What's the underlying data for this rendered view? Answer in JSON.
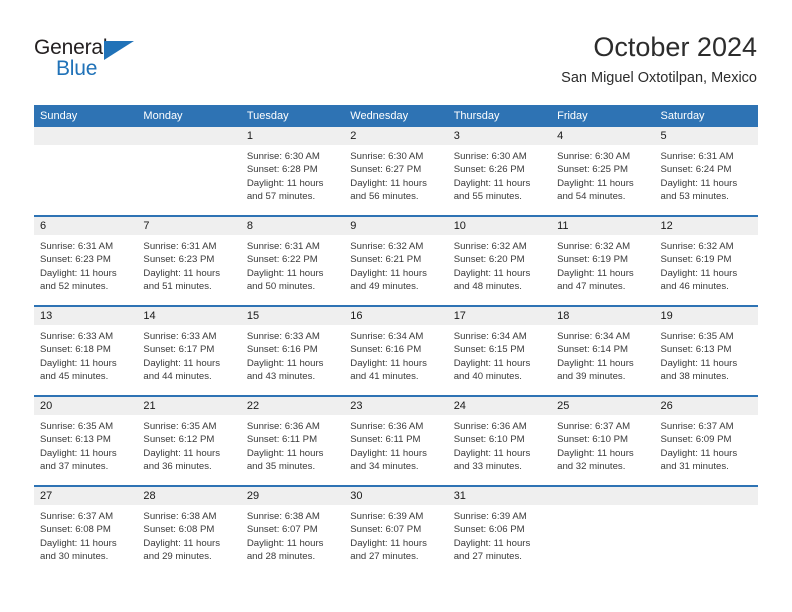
{
  "brand": {
    "name_part1": "General",
    "name_part2": "Blue"
  },
  "header": {
    "month_title": "October 2024",
    "location": "San Miguel Oxtotilpan, Mexico"
  },
  "calendar": {
    "weekday_headers": [
      "Sunday",
      "Monday",
      "Tuesday",
      "Wednesday",
      "Thursday",
      "Friday",
      "Saturday"
    ],
    "accent_color": "#2e73b4",
    "daynum_bg": "#efefef",
    "weeks": [
      [
        {
          "day": "",
          "sunrise": "",
          "sunset": "",
          "daylight": ""
        },
        {
          "day": "",
          "sunrise": "",
          "sunset": "",
          "daylight": ""
        },
        {
          "day": "1",
          "sunrise": "Sunrise: 6:30 AM",
          "sunset": "Sunset: 6:28 PM",
          "daylight": "Daylight: 11 hours and 57 minutes."
        },
        {
          "day": "2",
          "sunrise": "Sunrise: 6:30 AM",
          "sunset": "Sunset: 6:27 PM",
          "daylight": "Daylight: 11 hours and 56 minutes."
        },
        {
          "day": "3",
          "sunrise": "Sunrise: 6:30 AM",
          "sunset": "Sunset: 6:26 PM",
          "daylight": "Daylight: 11 hours and 55 minutes."
        },
        {
          "day": "4",
          "sunrise": "Sunrise: 6:30 AM",
          "sunset": "Sunset: 6:25 PM",
          "daylight": "Daylight: 11 hours and 54 minutes."
        },
        {
          "day": "5",
          "sunrise": "Sunrise: 6:31 AM",
          "sunset": "Sunset: 6:24 PM",
          "daylight": "Daylight: 11 hours and 53 minutes."
        }
      ],
      [
        {
          "day": "6",
          "sunrise": "Sunrise: 6:31 AM",
          "sunset": "Sunset: 6:23 PM",
          "daylight": "Daylight: 11 hours and 52 minutes."
        },
        {
          "day": "7",
          "sunrise": "Sunrise: 6:31 AM",
          "sunset": "Sunset: 6:23 PM",
          "daylight": "Daylight: 11 hours and 51 minutes."
        },
        {
          "day": "8",
          "sunrise": "Sunrise: 6:31 AM",
          "sunset": "Sunset: 6:22 PM",
          "daylight": "Daylight: 11 hours and 50 minutes."
        },
        {
          "day": "9",
          "sunrise": "Sunrise: 6:32 AM",
          "sunset": "Sunset: 6:21 PM",
          "daylight": "Daylight: 11 hours and 49 minutes."
        },
        {
          "day": "10",
          "sunrise": "Sunrise: 6:32 AM",
          "sunset": "Sunset: 6:20 PM",
          "daylight": "Daylight: 11 hours and 48 minutes."
        },
        {
          "day": "11",
          "sunrise": "Sunrise: 6:32 AM",
          "sunset": "Sunset: 6:19 PM",
          "daylight": "Daylight: 11 hours and 47 minutes."
        },
        {
          "day": "12",
          "sunrise": "Sunrise: 6:32 AM",
          "sunset": "Sunset: 6:19 PM",
          "daylight": "Daylight: 11 hours and 46 minutes."
        }
      ],
      [
        {
          "day": "13",
          "sunrise": "Sunrise: 6:33 AM",
          "sunset": "Sunset: 6:18 PM",
          "daylight": "Daylight: 11 hours and 45 minutes."
        },
        {
          "day": "14",
          "sunrise": "Sunrise: 6:33 AM",
          "sunset": "Sunset: 6:17 PM",
          "daylight": "Daylight: 11 hours and 44 minutes."
        },
        {
          "day": "15",
          "sunrise": "Sunrise: 6:33 AM",
          "sunset": "Sunset: 6:16 PM",
          "daylight": "Daylight: 11 hours and 43 minutes."
        },
        {
          "day": "16",
          "sunrise": "Sunrise: 6:34 AM",
          "sunset": "Sunset: 6:16 PM",
          "daylight": "Daylight: 11 hours and 41 minutes."
        },
        {
          "day": "17",
          "sunrise": "Sunrise: 6:34 AM",
          "sunset": "Sunset: 6:15 PM",
          "daylight": "Daylight: 11 hours and 40 minutes."
        },
        {
          "day": "18",
          "sunrise": "Sunrise: 6:34 AM",
          "sunset": "Sunset: 6:14 PM",
          "daylight": "Daylight: 11 hours and 39 minutes."
        },
        {
          "day": "19",
          "sunrise": "Sunrise: 6:35 AM",
          "sunset": "Sunset: 6:13 PM",
          "daylight": "Daylight: 11 hours and 38 minutes."
        }
      ],
      [
        {
          "day": "20",
          "sunrise": "Sunrise: 6:35 AM",
          "sunset": "Sunset: 6:13 PM",
          "daylight": "Daylight: 11 hours and 37 minutes."
        },
        {
          "day": "21",
          "sunrise": "Sunrise: 6:35 AM",
          "sunset": "Sunset: 6:12 PM",
          "daylight": "Daylight: 11 hours and 36 minutes."
        },
        {
          "day": "22",
          "sunrise": "Sunrise: 6:36 AM",
          "sunset": "Sunset: 6:11 PM",
          "daylight": "Daylight: 11 hours and 35 minutes."
        },
        {
          "day": "23",
          "sunrise": "Sunrise: 6:36 AM",
          "sunset": "Sunset: 6:11 PM",
          "daylight": "Daylight: 11 hours and 34 minutes."
        },
        {
          "day": "24",
          "sunrise": "Sunrise: 6:36 AM",
          "sunset": "Sunset: 6:10 PM",
          "daylight": "Daylight: 11 hours and 33 minutes."
        },
        {
          "day": "25",
          "sunrise": "Sunrise: 6:37 AM",
          "sunset": "Sunset: 6:10 PM",
          "daylight": "Daylight: 11 hours and 32 minutes."
        },
        {
          "day": "26",
          "sunrise": "Sunrise: 6:37 AM",
          "sunset": "Sunset: 6:09 PM",
          "daylight": "Daylight: 11 hours and 31 minutes."
        }
      ],
      [
        {
          "day": "27",
          "sunrise": "Sunrise: 6:37 AM",
          "sunset": "Sunset: 6:08 PM",
          "daylight": "Daylight: 11 hours and 30 minutes."
        },
        {
          "day": "28",
          "sunrise": "Sunrise: 6:38 AM",
          "sunset": "Sunset: 6:08 PM",
          "daylight": "Daylight: 11 hours and 29 minutes."
        },
        {
          "day": "29",
          "sunrise": "Sunrise: 6:38 AM",
          "sunset": "Sunset: 6:07 PM",
          "daylight": "Daylight: 11 hours and 28 minutes."
        },
        {
          "day": "30",
          "sunrise": "Sunrise: 6:39 AM",
          "sunset": "Sunset: 6:07 PM",
          "daylight": "Daylight: 11 hours and 27 minutes."
        },
        {
          "day": "31",
          "sunrise": "Sunrise: 6:39 AM",
          "sunset": "Sunset: 6:06 PM",
          "daylight": "Daylight: 11 hours and 27 minutes."
        },
        {
          "day": "",
          "sunrise": "",
          "sunset": "",
          "daylight": ""
        },
        {
          "day": "",
          "sunrise": "",
          "sunset": "",
          "daylight": ""
        }
      ]
    ]
  }
}
